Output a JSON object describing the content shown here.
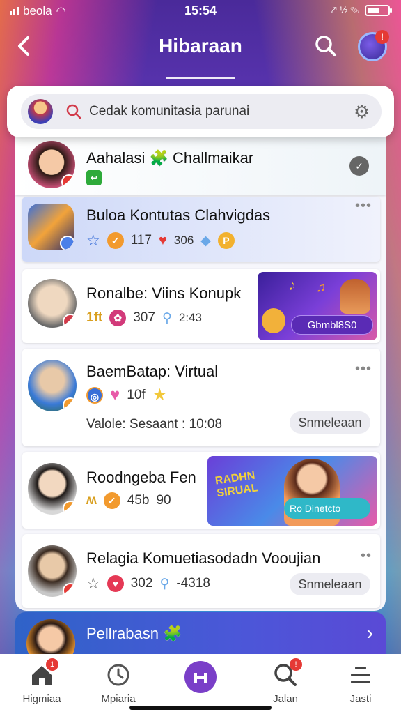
{
  "status_bar": {
    "carrier": "beola",
    "time": "15:54",
    "right_icons": "⤤ ½ ✎"
  },
  "header": {
    "back_icon": "‹",
    "title": "Hibaraan",
    "notification_badge": "!"
  },
  "search": {
    "placeholder": "Cedak komunitasia parunai"
  },
  "cards": [
    {
      "name": "Aahalasi 🧩 Challmaikar",
      "badge": "↩"
    },
    {
      "name": "Buloa Kontutas Clahvigdas",
      "count1": "117",
      "count2": "306"
    },
    {
      "name": "Ronalbe: Viins Konupk",
      "prefix": "1ft",
      "count1": "307",
      "count2": "2:43",
      "banner_button": "Gbmbl8S0"
    },
    {
      "name": "BaemBatap: Virtual",
      "count1": "10f",
      "status": "Valole: Sesaant : 10:08",
      "button": "Snmeleaan"
    },
    {
      "name": "Roodngeba Fen",
      "count1": "45b",
      "count2": "90",
      "banner_title": "RADHN SIRUAL",
      "banner_button": "Ro Dinetcto"
    },
    {
      "name": "Relagia Komuetiasodadn Vooujian",
      "count1": "302",
      "count2": "-4318",
      "button": "Snmeleaan"
    }
  ],
  "bottom_card": {
    "title": "Pellrabasn 🧩"
  },
  "tabs": [
    {
      "label": "Higmiaa",
      "icon": "home-icon",
      "badge": "1"
    },
    {
      "label": "Mpiaria",
      "icon": "clock-icon"
    },
    {
      "label": "",
      "icon": "center-action-icon"
    },
    {
      "label": "Jalan",
      "icon": "search-icon",
      "badge": "!"
    },
    {
      "label": "Jasti",
      "icon": "menu-icon"
    }
  ],
  "colors": {
    "accent_purple": "#5b2bb5",
    "brand_red": "#e53935",
    "orange": "#f29a2e"
  }
}
